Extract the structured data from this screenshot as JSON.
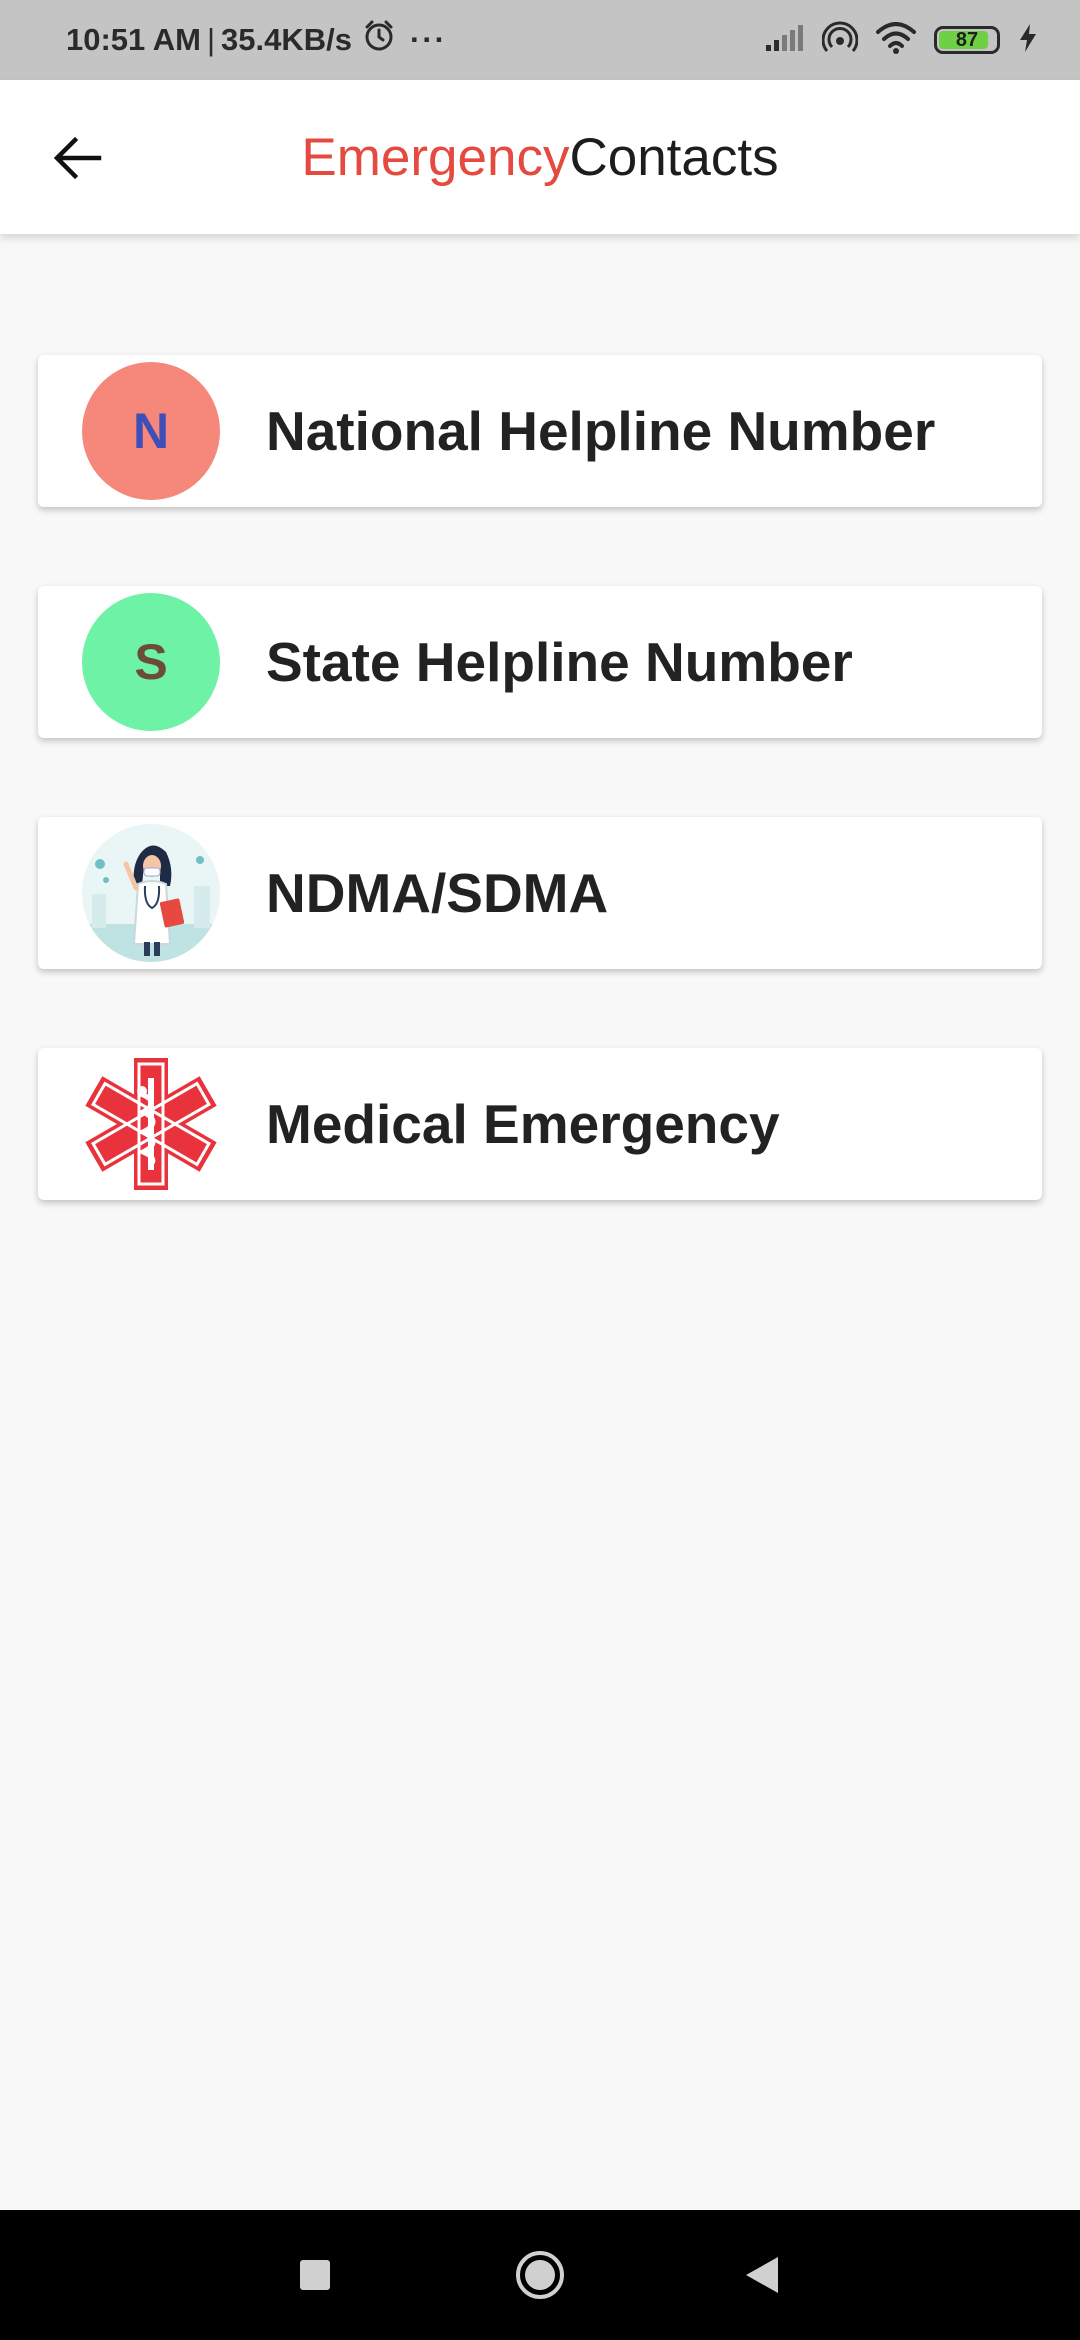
{
  "status_bar": {
    "time": "10:51 AM",
    "separator": "|",
    "net_speed": "35.4KB/s",
    "dots": "···",
    "battery_level": 87,
    "battery_text": "87",
    "icons": [
      "alarm-icon",
      "signal-icon",
      "hotspot-icon",
      "wifi-icon",
      "battery-icon",
      "charging-icon"
    ]
  },
  "app_bar": {
    "title_part1": "Emergency",
    "title_part2": "Contacts",
    "title_part1_color": "#e5493f",
    "back_icon": "back-arrow-icon"
  },
  "contacts": [
    {
      "avatar_letter": "N",
      "avatar_bg": "#f6877b",
      "avatar_fg": "#3f4fb8",
      "label": "National Helpline Number"
    },
    {
      "avatar_letter": "S",
      "avatar_bg": "#6ef2a6",
      "avatar_fg": "#6b4b3a",
      "label": "State Helpline Number"
    },
    {
      "avatar_image": "doctor-illustration",
      "label": "NDMA/SDMA"
    },
    {
      "avatar_image": "star-of-life-icon",
      "avatar_color": "#e8323c",
      "label": "Medical Emergency"
    }
  ],
  "nav_bar": {
    "buttons": [
      "recents-square-icon",
      "home-circle-icon",
      "back-triangle-icon"
    ]
  }
}
